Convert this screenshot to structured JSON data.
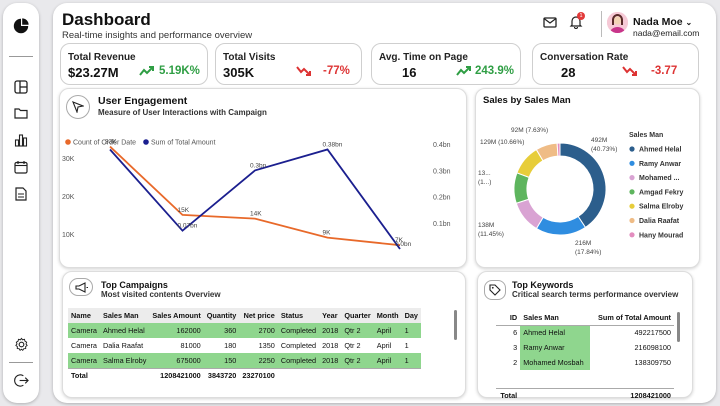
{
  "header": {
    "title": "Dashboard",
    "subtitle": "Real-time insights and performance overview",
    "notification_badge": "1",
    "user_name": "Nada Moe",
    "user_email": "nada@email.com"
  },
  "kpis": [
    {
      "label": "Total Revenue",
      "value": "$23.27M",
      "change": "5.19K%",
      "trend": "up"
    },
    {
      "label": "Total Visits",
      "value": "305K",
      "change": "-77%",
      "trend": "down"
    },
    {
      "label": "Avg. Time on Page",
      "value": "16",
      "change": "243.9%",
      "trend": "up"
    },
    {
      "label": "Conversation Rate",
      "value": "28",
      "change": "-3.77",
      "trend": "down"
    }
  ],
  "engagement": {
    "title": "User Engagement",
    "subtitle": "Measure of User Interactions with Campaign",
    "legend": [
      "Count of Order Date",
      "Sum of Total  Amount"
    ]
  },
  "sales_by_man": {
    "title": "Sales by Sales Man",
    "legend_title": "Sales Man"
  },
  "chart_data": [
    {
      "type": "line",
      "left_axis_ticks": [
        "30K",
        "20K",
        "10K"
      ],
      "right_axis_ticks": [
        "0.4bn",
        "0.3bn",
        "0.2bn",
        "0.1bn"
      ],
      "series": [
        {
          "name": "Count of Order Date",
          "color": "#e8692a",
          "axis": "left",
          "values": [
            33000,
            15000,
            14000,
            9000,
            7000
          ],
          "labels": [
            "33K",
            "15K",
            "14K",
            "9K",
            "7K"
          ]
        },
        {
          "name": "Sum of Total  Amount",
          "color": "#1b1f8f",
          "axis": "right",
          "values": [
            0.38,
            0.07,
            0.3,
            0.38,
            0.0
          ],
          "labels": [
            "",
            "0.07bn",
            "0.3bn",
            "0.38bn",
            "0.0bn"
          ]
        }
      ]
    },
    {
      "type": "pie",
      "donut": true,
      "slices": [
        {
          "name": "Ahmed Helal",
          "value": 492,
          "label": "492M",
          "pct": "(40.73%)",
          "color": "#2c5e8c"
        },
        {
          "name": "Ramy Anwar",
          "value": 216,
          "label": "216M",
          "pct": "(17.84%)",
          "color": "#2f8de0"
        },
        {
          "name": "Mohamed ...",
          "value": 138,
          "label": "138M",
          "pct": "(11.45%)",
          "color": "#d9a3d3"
        },
        {
          "name": "Amgad Fekry",
          "value": 130,
          "label": "13...",
          "pct": "(1...)",
          "color": "#5eb55e"
        },
        {
          "name": "Salma Elroby",
          "value": 129,
          "label": "129M",
          "pct": "(10.66%)",
          "color": "#e7cd3a"
        },
        {
          "name": "Dalia Raafat",
          "value": 92,
          "label": "92M",
          "pct": "(7.63%)",
          "color": "#efbc86"
        },
        {
          "name": "Hany Mourad",
          "value": 12,
          "label": "",
          "pct": "",
          "color": "#e38dbf"
        }
      ]
    }
  ],
  "campaigns": {
    "title": "Top Campaigns",
    "subtitle": "Most visited contents Overview",
    "columns": [
      "Name",
      "Sales Man",
      "Sales Amount",
      "Quantity",
      "Net price",
      "Status",
      "Year",
      "Quarter",
      "Month",
      "Day"
    ],
    "rows": [
      [
        "Camera",
        "Ahmed Helal",
        "162000",
        "360",
        "2700",
        "Completed",
        "2018",
        "Qtr 2",
        "April",
        "1"
      ],
      [
        "Camera",
        "Dalia Raafat",
        "81000",
        "180",
        "1350",
        "Completed",
        "2018",
        "Qtr 2",
        "April",
        "1"
      ],
      [
        "Camera",
        "Salma Elroby",
        "675000",
        "150",
        "2250",
        "Completed",
        "2018",
        "Qtr 2",
        "April",
        "1"
      ]
    ],
    "total": [
      "Total",
      "",
      "1208421000",
      "3843720",
      "23270100",
      "",
      "",
      "",
      "",
      ""
    ]
  },
  "keywords": {
    "title": "Top Keywords",
    "subtitle": "Critical search terms performance overview",
    "columns": [
      "ID",
      "Sales Man",
      "Sum of Total Amount"
    ],
    "rows": [
      [
        "6",
        "Ahmed Helal",
        "492217500"
      ],
      [
        "3",
        "Ramy Anwar",
        "216098100"
      ],
      [
        "2",
        "Mohamed Mosbah",
        "138309750"
      ]
    ],
    "total": [
      "Total",
      "",
      "1208421000"
    ]
  }
}
